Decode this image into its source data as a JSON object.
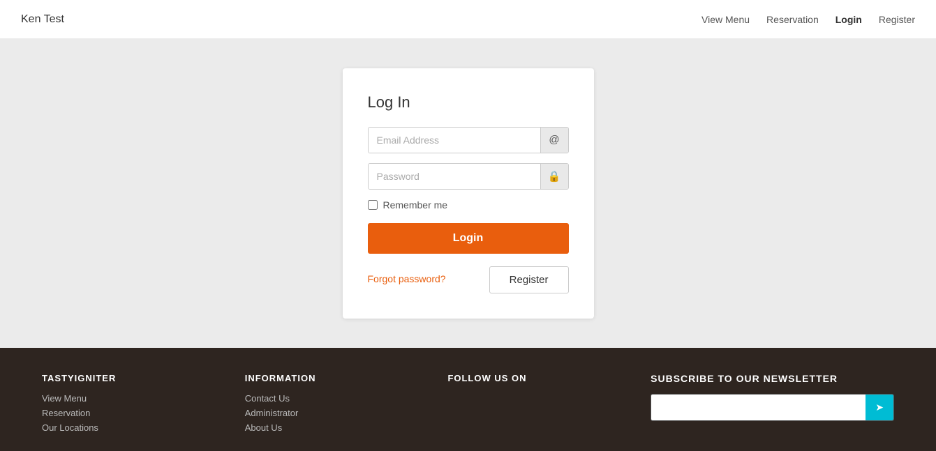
{
  "header": {
    "logo_text": "Ken Test",
    "nav": {
      "view_menu": "View Menu",
      "reservation": "Reservation",
      "login": "Login",
      "register": "Register"
    }
  },
  "login_card": {
    "title": "Log In",
    "email_placeholder": "Email Address",
    "password_placeholder": "Password",
    "remember_label": "Remember me",
    "login_button": "Login",
    "forgot_label": "Forgot password?",
    "register_button": "Register"
  },
  "footer": {
    "col1": {
      "heading": "TASTYIGNITER",
      "links": [
        "View Menu",
        "Reservation",
        "Our Locations"
      ]
    },
    "col2": {
      "heading": "INFORMATION",
      "links": [
        "Contact Us",
        "Administrator",
        "About Us"
      ]
    },
    "col3": {
      "heading": "FOLLOW US ON"
    },
    "col4": {
      "heading": "Subscribe to our newsletter"
    }
  }
}
